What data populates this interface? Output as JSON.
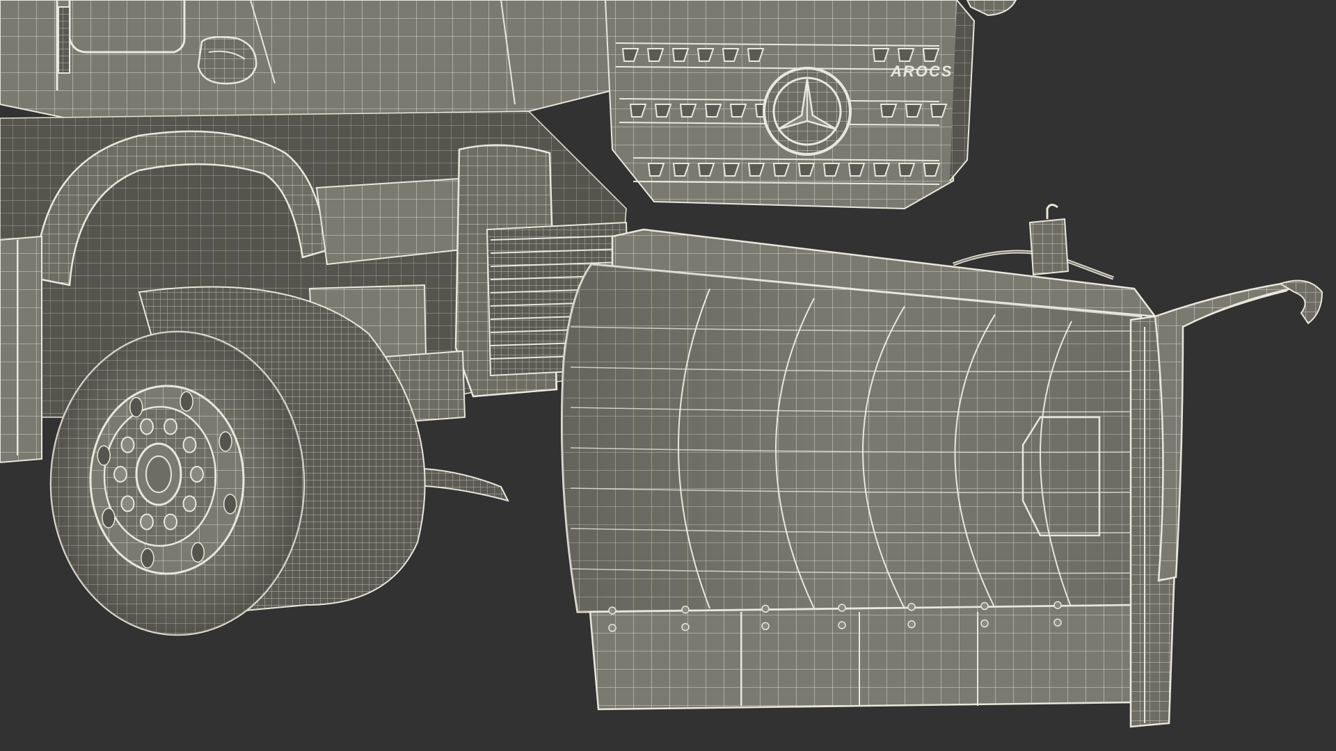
{
  "scene": {
    "subject": "snow-plow-truck-wireframe",
    "background_color": "#323232",
    "mesh_fill_color": "#7b7a70",
    "mesh_dark_color": "#5c5b53",
    "wire_color": "#e9e8dc"
  },
  "truck": {
    "badge_text": "AROCS"
  }
}
